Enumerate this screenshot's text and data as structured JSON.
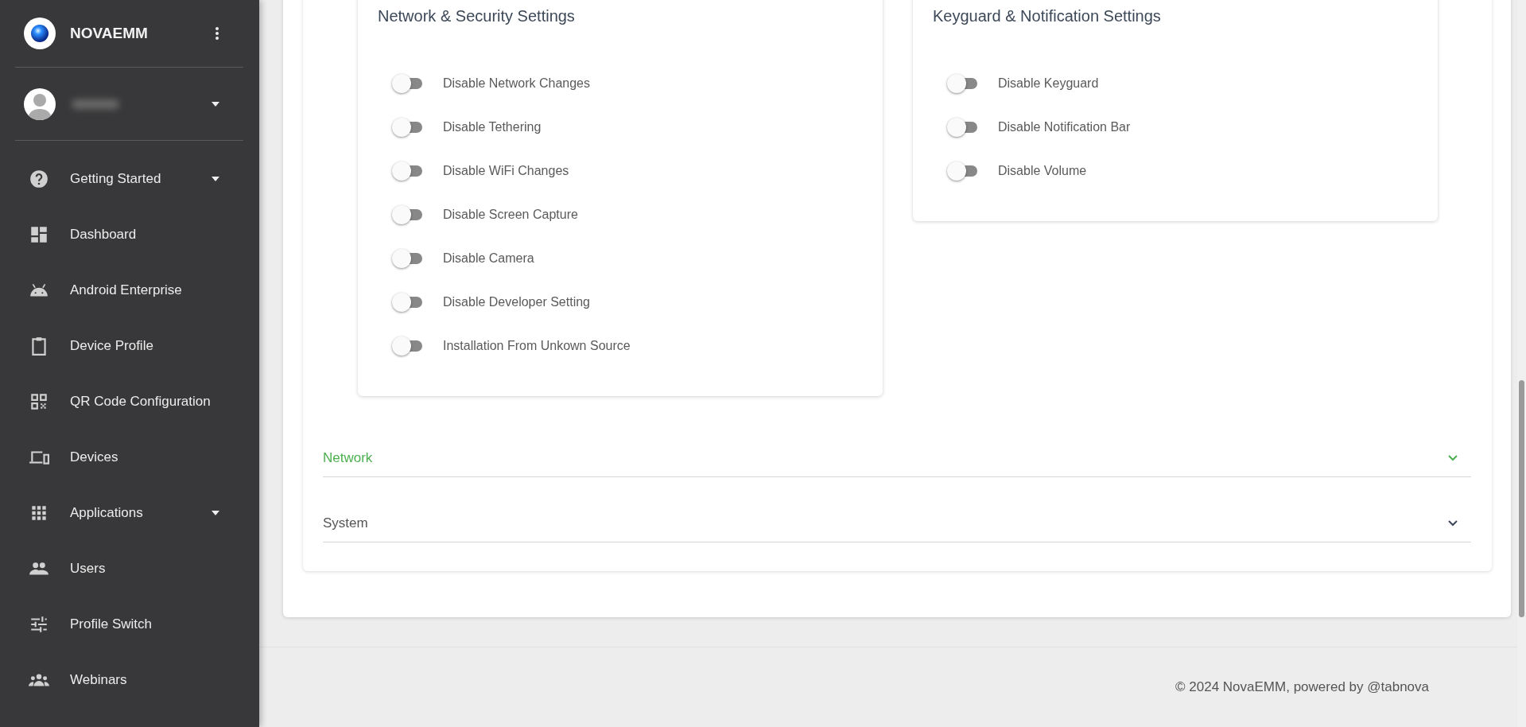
{
  "sidebar": {
    "brand": "NOVAEMM",
    "items": [
      {
        "label": "Getting Started",
        "expandable": true
      },
      {
        "label": "Dashboard",
        "expandable": false
      },
      {
        "label": "Android Enterprise",
        "expandable": false
      },
      {
        "label": "Device Profile",
        "expandable": false
      },
      {
        "label": "QR Code Configuration",
        "expandable": false
      },
      {
        "label": "Devices",
        "expandable": false
      },
      {
        "label": "Applications",
        "expandable": true
      },
      {
        "label": "Users",
        "expandable": false
      },
      {
        "label": "Profile Switch",
        "expandable": false
      },
      {
        "label": "Webinars",
        "expandable": false
      }
    ]
  },
  "settings_cards": [
    {
      "title": "Network & Security Settings",
      "toggles": [
        {
          "label": "Disable Network Changes",
          "on": false
        },
        {
          "label": "Disable Tethering",
          "on": false
        },
        {
          "label": "Disable WiFi Changes",
          "on": false
        },
        {
          "label": "Disable Screen Capture",
          "on": false
        },
        {
          "label": "Disable Camera",
          "on": false
        },
        {
          "label": "Disable Developer Setting",
          "on": false
        },
        {
          "label": "Installation From Unkown Source",
          "on": false
        }
      ]
    },
    {
      "title": "Keyguard & Notification Settings",
      "toggles": [
        {
          "label": "Disable Keyguard",
          "on": false
        },
        {
          "label": "Disable Notification Bar",
          "on": false
        },
        {
          "label": "Disable Volume",
          "on": false
        }
      ]
    }
  ],
  "accordion": [
    {
      "label": "Network",
      "active": true
    },
    {
      "label": "System",
      "active": false
    }
  ],
  "footer": "© 2024 NovaEMM, powered by @tabnova"
}
